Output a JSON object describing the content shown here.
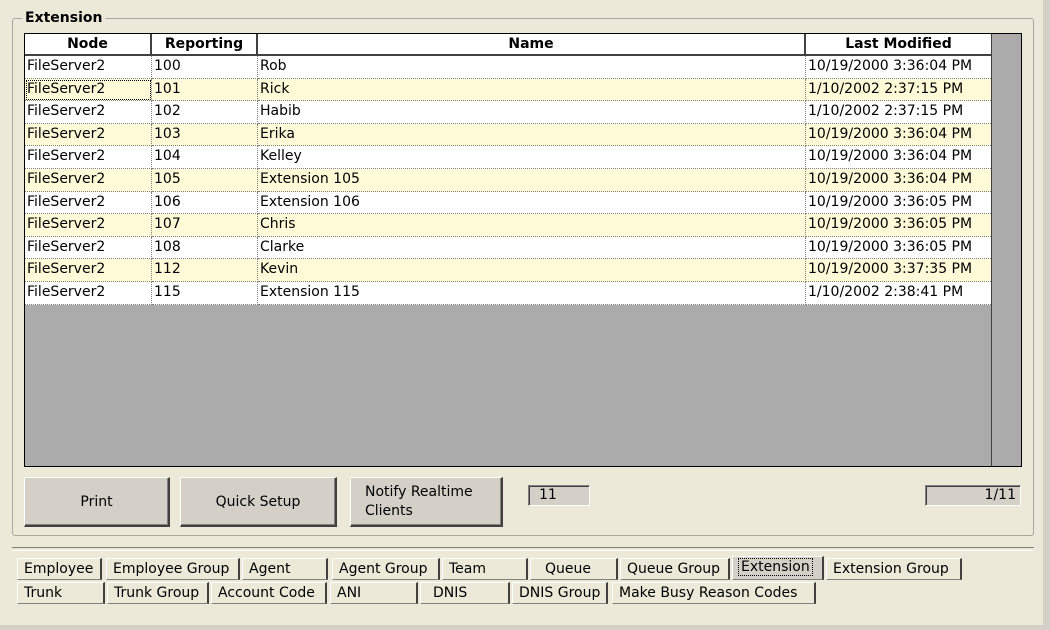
{
  "group": {
    "title": "Extension"
  },
  "grid": {
    "columns": [
      "Node",
      "Reporting",
      "Name",
      "Last Modified"
    ],
    "rows": [
      [
        "FileServer2",
        "100",
        "Rob",
        "10/19/2000 3:36:04 PM"
      ],
      [
        "FileServer2",
        "101",
        "Rick",
        "1/10/2002 2:37:15 PM"
      ],
      [
        "FileServer2",
        "102",
        "Habib",
        "1/10/2002 2:37:15 PM"
      ],
      [
        "FileServer2",
        "103",
        "Erika",
        "10/19/2000 3:36:04 PM"
      ],
      [
        "FileServer2",
        "104",
        "Kelley",
        "10/19/2000 3:36:04 PM"
      ],
      [
        "FileServer2",
        "105",
        "Extension 105",
        "10/19/2000 3:36:04 PM"
      ],
      [
        "FileServer2",
        "106",
        "Extension 106",
        "10/19/2000 3:36:05 PM"
      ],
      [
        "FileServer2",
        "107",
        "Chris",
        "10/19/2000 3:36:05 PM"
      ],
      [
        "FileServer2",
        "108",
        "Clarke",
        "10/19/2000 3:36:05 PM"
      ],
      [
        "FileServer2",
        "112",
        "Kevin",
        "10/19/2000 3:37:35 PM"
      ],
      [
        "FileServer2",
        "115",
        "Extension 115",
        "1/10/2002 2:38:41 PM"
      ]
    ],
    "row_colors": {
      "odd": "#ffffff",
      "even": "#fffbd8"
    }
  },
  "buttons": {
    "print": "Print",
    "quick_setup": "Quick Setup",
    "notify_line1": "Notify Realtime",
    "notify_line2": "Clients"
  },
  "record_count": "11",
  "page_indicator": "1/11",
  "tabs_row1": [
    "Employee",
    "Employee Group",
    "Agent",
    "Agent Group",
    "Team",
    "Queue",
    "Queue Group",
    "Extension",
    "Extension Group"
  ],
  "tabs_row2": [
    "Trunk",
    "Trunk Group",
    "Account Code",
    "ANI",
    "DNIS",
    "DNIS Group",
    "Make Busy Reason Codes"
  ],
  "active_tab": "Extension"
}
